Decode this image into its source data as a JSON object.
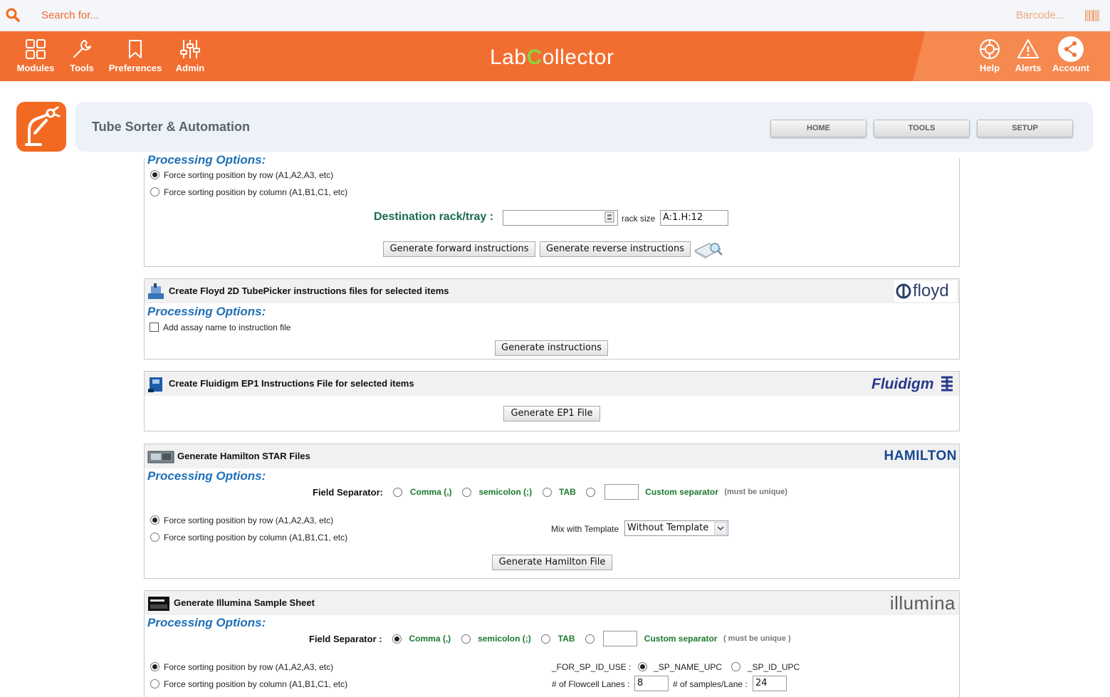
{
  "search": {
    "placeholder": "Search for...",
    "barcode": "Barcode..."
  },
  "nav": {
    "left": [
      {
        "label": "Modules"
      },
      {
        "label": "Tools"
      },
      {
        "label": "Preferences"
      },
      {
        "label": "Admin"
      }
    ],
    "logo": {
      "part1": "Lab",
      "part2": "C",
      "part3": "ollector"
    },
    "right": [
      {
        "label": "Help"
      },
      {
        "label": "Alerts"
      },
      {
        "label": "Account"
      }
    ]
  },
  "module": {
    "title": "Tube Sorter & Automation",
    "buttons": [
      "HOME",
      "TOOLS",
      "SETUP"
    ]
  },
  "panel1": {
    "processing_options": "Processing Options:",
    "opt_row": "Force sorting position by row (A1,A2,A3, etc)",
    "opt_col": "Force sorting position by column (A1,B1,C1, etc)",
    "dest_label": "Destination rack/tray :",
    "dest_value": "",
    "rack_size_label": "rack size",
    "rack_size_value": "A:1.H:12",
    "btn_forward": "Generate forward instructions",
    "btn_reverse": "Generate reverse instructions"
  },
  "floyd": {
    "title": "Create Floyd 2D TubePicker instructions files for selected items",
    "brand": "floyd",
    "processing_options": "Processing Options:",
    "checkbox_label": "Add assay name to instruction file",
    "button": "Generate instructions"
  },
  "fluidigm": {
    "title": "Create Fluidigm EP1 Instructions File for selected items",
    "brand": "Fluidigm",
    "button": "Generate EP1 File"
  },
  "hamilton": {
    "title": "Generate Hamilton STAR Files",
    "brand": "HAMILT",
    "brand_o": "O",
    "brand_end": "N",
    "processing_options": "Processing Options:",
    "field_separator": "Field Separator:",
    "sep_comma": "Comma (,)",
    "sep_semicolon": "semicolon (;)",
    "sep_tab": "TAB",
    "custom_separator": "Custom separator",
    "custom_note": "(must be unique)",
    "opt_row": "Force sorting position by row (A1,A2,A3, etc)",
    "opt_col": "Force sorting position by column (A1,B1,C1, etc)",
    "mix_label": "Mix with Template",
    "mix_value": "Without Template",
    "button": "Generate Hamilton File"
  },
  "illumina": {
    "title": "Generate Illumina Sample Sheet",
    "brand": "illumina",
    "processing_options": "Processing Options:",
    "field_separator": "Field Separator :",
    "sep_comma": "Comma (,)",
    "sep_semicolon": "semicolon (;)",
    "sep_tab": "TAB",
    "custom_separator": "Custom separator",
    "custom_note": "( must be unique )",
    "opt_row": "Force sorting position by row (A1,A2,A3, etc)",
    "opt_col": "Force sorting position by column (A1,B1,C1, etc)",
    "for_sp_label": "_FOR_SP_ID_USE :",
    "sp_name": "_SP_NAME_UPC",
    "sp_id": "_SP_ID_UPC",
    "flowcell_label": "# of Flowcell Lanes :",
    "flowcell_value": "8",
    "samples_label": "# of samples/Lane :",
    "samples_value": "24"
  }
}
